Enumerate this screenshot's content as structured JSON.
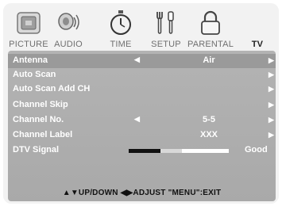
{
  "tabs": [
    {
      "label": "PICTURE",
      "icon": "picture-icon"
    },
    {
      "label": "AUDIO",
      "icon": "audio-icon"
    },
    {
      "label": "TIME",
      "icon": "stopwatch-icon"
    },
    {
      "label": "SETUP",
      "icon": "tools-icon"
    },
    {
      "label": "PARENTAL",
      "icon": "lock-icon"
    },
    {
      "label": "TV",
      "icon": "tv-icon",
      "icon_text": "TV",
      "active": true
    }
  ],
  "menu": {
    "antenna": {
      "label": "Antenna",
      "value": "Air"
    },
    "auto_scan": {
      "label": "Auto Scan"
    },
    "auto_scan_add": {
      "label": "Auto Scan Add CH"
    },
    "channel_skip": {
      "label": "Channel Skip"
    },
    "channel_no": {
      "label": "Channel No.",
      "value": "5-5"
    },
    "channel_label": {
      "label": "Channel Label",
      "value": "XXX"
    },
    "dtv_signal": {
      "label": "DTV Signal",
      "quality": "Good",
      "strength": 0.53
    }
  },
  "footer": "▲▼UP/DOWN  ◀▶ADJUST  \"MENU\":EXIT",
  "colors": {
    "panel": "#b0b0b0",
    "selected_row": "#9a9a9a",
    "text": "#ffffff"
  }
}
